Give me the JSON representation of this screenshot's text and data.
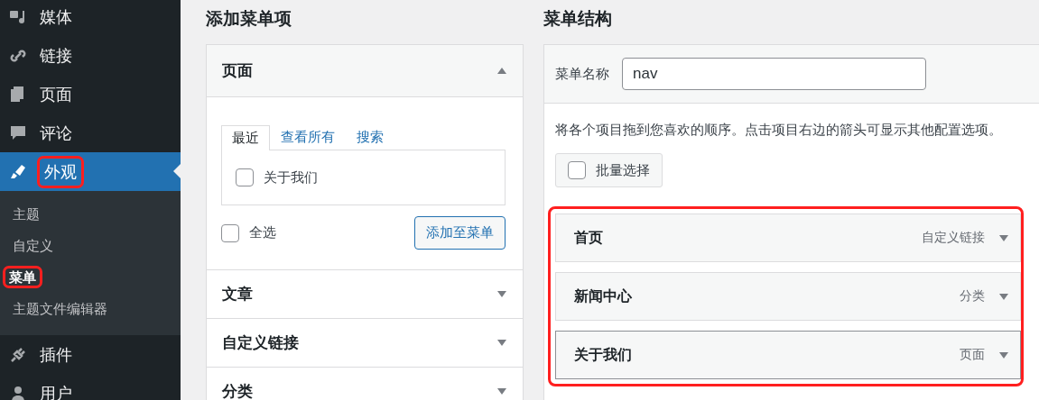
{
  "sidebar": {
    "items": [
      {
        "label": "媒体",
        "selected": false,
        "annotated": false
      },
      {
        "label": "链接",
        "selected": false,
        "annotated": false
      },
      {
        "label": "页面",
        "selected": false,
        "annotated": false
      },
      {
        "label": "评论",
        "selected": false,
        "annotated": false
      },
      {
        "label": "外观",
        "selected": true,
        "annotated": true,
        "children": [
          {
            "label": "主题",
            "selected": false,
            "annotated": false
          },
          {
            "label": "自定义",
            "selected": false,
            "annotated": false
          },
          {
            "label": "菜单",
            "selected": true,
            "annotated": true
          },
          {
            "label": "主题文件编辑器",
            "selected": false,
            "annotated": false
          }
        ]
      },
      {
        "label": "插件",
        "selected": false,
        "annotated": false
      },
      {
        "label": "用户",
        "selected": false,
        "annotated": false
      }
    ]
  },
  "add_items": {
    "heading": "添加菜单项",
    "sections": [
      {
        "title": "页面",
        "expanded": true,
        "tabs": [
          {
            "label": "最近",
            "selected": true
          },
          {
            "label": "查看所有",
            "selected": false
          },
          {
            "label": "搜索",
            "selected": false
          }
        ],
        "items": [
          {
            "label": "关于我们",
            "checked": false
          }
        ],
        "select_all": {
          "label": "全选",
          "checked": false
        },
        "add_button": "添加至菜单"
      },
      {
        "title": "文章",
        "expanded": false
      },
      {
        "title": "自定义链接",
        "expanded": false
      },
      {
        "title": "分类",
        "expanded": false
      }
    ]
  },
  "menu_structure": {
    "heading": "菜单结构",
    "name_label": "菜单名称",
    "name_value": "nav",
    "instructions": "将各个项目拖到您喜欢的顺序。点击项目右边的箭头可显示其他配置选项。",
    "bulk_select": {
      "label": "批量选择",
      "checked": false
    },
    "items_annotated": true,
    "items": [
      {
        "title": "首页",
        "type": "自定义链接",
        "selected": false
      },
      {
        "title": "新闻中心",
        "type": "分类",
        "selected": false
      },
      {
        "title": "关于我们",
        "type": "页面",
        "selected": true
      }
    ]
  }
}
